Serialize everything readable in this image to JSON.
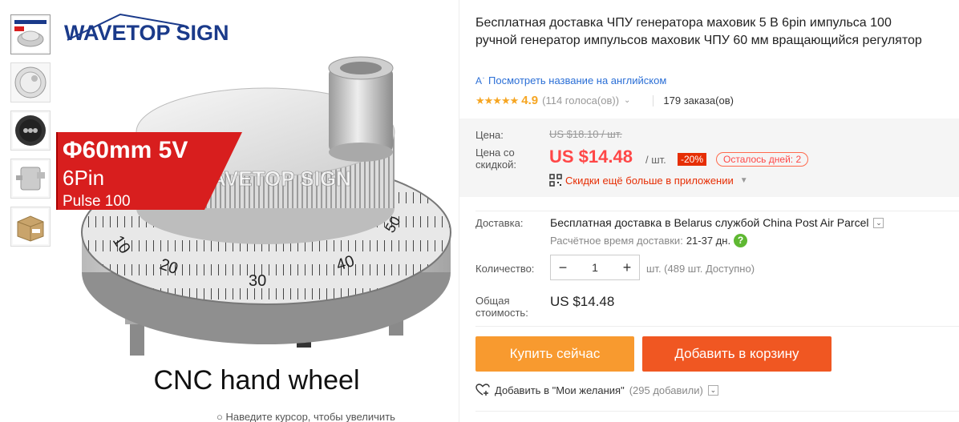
{
  "gallery": {
    "thumbnails": [
      "thumb-1",
      "thumb-2",
      "thumb-3",
      "thumb-4",
      "thumb-5"
    ],
    "main_image": {
      "brand": "WAVETOP SIGN",
      "watermark": "WAVETOP SIGN",
      "spec_line1": "Φ60mm 5V",
      "spec_line2": "6Pin",
      "spec_line3": "Pulse 100",
      "dial_numbers": [
        "10",
        "20",
        "30",
        "40",
        "50"
      ],
      "caption": "CNC hand wheel"
    },
    "zoom_hint": "Наведите курсор, чтобы увеличить"
  },
  "product": {
    "title": "Бесплатная доставка ЧПУ генератора маховик 5 В 6pin импульса 100 ручной генератор импульсов маховик ЧПУ 60 мм вращающийся регулятор",
    "translate_link": "Посмотреть название на английском",
    "translate_icon": "translate-icon",
    "stars": "★★★★★",
    "rating": "4.9",
    "votes": "(114 голоса(ов))",
    "orders": "179 заказа(ов)"
  },
  "price": {
    "label": "Цена:",
    "old": "US $18.10 / шт.",
    "discount_label": "Цена со скидкой:",
    "current": "US $14.48",
    "unit": "/ шт.",
    "discount_badge": "-20%",
    "days_left": "Осталось дней: 2",
    "app_discount": "Скидки ещё больше в приложении"
  },
  "shipping": {
    "label": "Доставка:",
    "method": "Бесплатная доставка в Belarus службой China Post Air Parcel",
    "estimate_label": "Расчётное время доставки:",
    "estimate_days": "21-37 дн.",
    "help": "?"
  },
  "quantity": {
    "label": "Количество:",
    "minus": "−",
    "value": "1",
    "plus": "+",
    "note": "шт. (489 шт. Доступно)"
  },
  "total": {
    "label": "Общая стоимость:",
    "value": "US $14.48"
  },
  "actions": {
    "buy_now": "Купить сейчас",
    "add_to_cart": "Добавить в корзину"
  },
  "wishlist": {
    "label": "Добавить в \"Мои желания\"",
    "count": "(295 добавили)"
  },
  "colors": {
    "price_red": "#ff4747",
    "buy_orange": "#f89a2f",
    "cart_orange": "#f05722",
    "link_blue": "#2b6fd6",
    "star_gold": "#f6a623"
  }
}
